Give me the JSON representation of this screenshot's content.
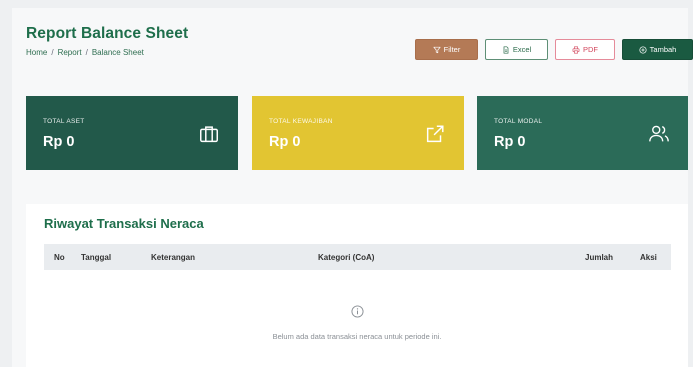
{
  "header": {
    "title": "Report Balance Sheet",
    "breadcrumb": [
      "Home",
      "Report",
      "Balance Sheet"
    ],
    "breadcrumb_separator": "/"
  },
  "toolbar": {
    "filter_label": "Filter",
    "excel_label": "Excel",
    "pdf_label": "PDF",
    "tambah_label": "Tambah"
  },
  "summary": {
    "aset": {
      "label": "TOTAL ASET",
      "value": "Rp 0",
      "icon": "briefcase-icon",
      "color": "#22594a"
    },
    "kewajiban": {
      "label": "TOTAL KEWAJIBAN",
      "value": "Rp 0",
      "icon": "external-link-icon",
      "color": "#e2c532"
    },
    "modal": {
      "label": "TOTAL MODAL",
      "value": "Rp 0",
      "icon": "users-icon",
      "color": "#2b6b58"
    }
  },
  "history": {
    "title": "Riwayat Transaksi Neraca",
    "columns": [
      "No",
      "Tanggal",
      "Keterangan",
      "Kategori (CoA)",
      "Jumlah",
      "Aksi"
    ],
    "empty_icon": "info-icon",
    "empty_text": "Belum ada data transaksi neraca untuk periode ini."
  },
  "colors": {
    "brand_green": "#1e6e4b",
    "filter_brown": "#b47a56",
    "pdf_red": "#d2465c",
    "tambah_dark_green": "#1a5a41"
  }
}
